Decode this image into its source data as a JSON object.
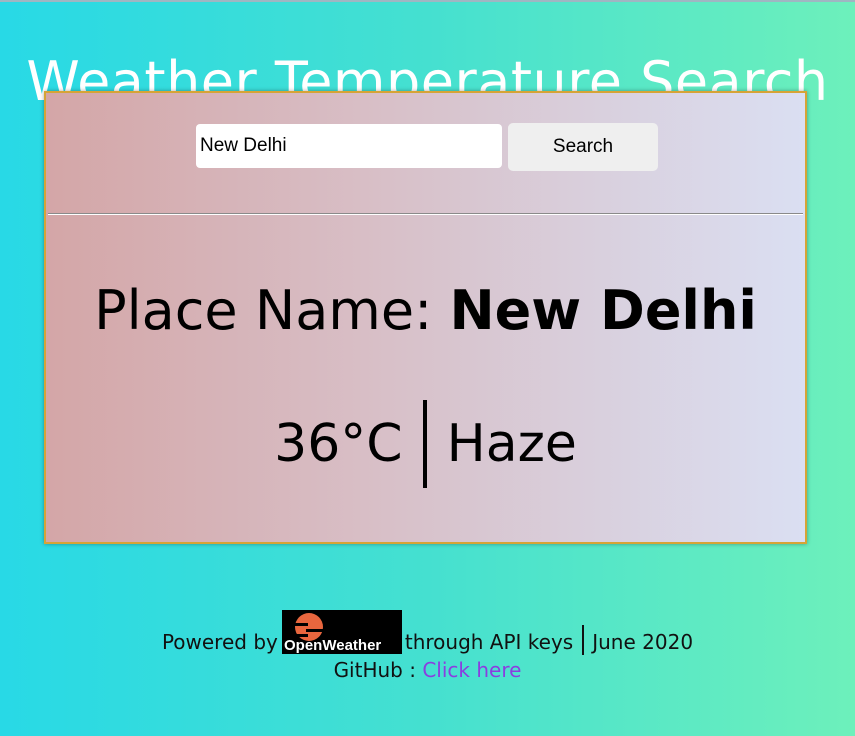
{
  "header": {
    "title": "Weather Temperature Search"
  },
  "search": {
    "input_value": "New Delhi",
    "button_label": "Search"
  },
  "result": {
    "place_label": "Place Name: ",
    "place_value": "New Delhi",
    "temperature": "36°C",
    "condition": "Haze"
  },
  "footer": {
    "powered_prefix": "Powered by",
    "logo_text": "OpenWeather",
    "powered_suffix": "through API keys",
    "date": "June 2020",
    "github_label": "GitHub : ",
    "github_link": "Click here"
  },
  "colors": {
    "background_start": "#28d9e6",
    "background_end": "#6df0bb",
    "card_border": "#d6a436",
    "link": "#8a3ee0",
    "logo_sun": "#e8663e"
  },
  "icons": {
    "logo": "openweather-logo"
  }
}
